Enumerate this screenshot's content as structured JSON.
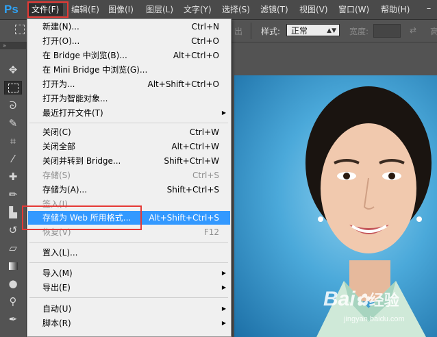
{
  "app": {
    "logo": "Ps"
  },
  "menubar": {
    "items": [
      {
        "label": "文件(F)",
        "active": true
      },
      {
        "label": "编辑(E)"
      },
      {
        "label": "图像(I)"
      },
      {
        "label": "图层(L)"
      },
      {
        "label": "文字(Y)"
      },
      {
        "label": "选择(S)"
      },
      {
        "label": "滤镜(T)"
      },
      {
        "label": "视图(V)"
      },
      {
        "label": "窗口(W)"
      },
      {
        "label": "帮助(H)"
      }
    ]
  },
  "options_bar": {
    "dimmed_label": "出",
    "style_label": "样式:",
    "style_value": "正常",
    "width_label": "宽度:",
    "height_label": "高"
  },
  "file_menu": {
    "items": [
      {
        "label": "新建(N)...",
        "shortcut": "Ctrl+N"
      },
      {
        "label": "打开(O)...",
        "shortcut": "Ctrl+O"
      },
      {
        "label": "在 Bridge 中浏览(B)...",
        "shortcut": "Alt+Ctrl+O"
      },
      {
        "label": "在 Mini Bridge 中浏览(G)...",
        "shortcut": ""
      },
      {
        "label": "打开为...",
        "shortcut": "Alt+Shift+Ctrl+O"
      },
      {
        "label": "打开为智能对象...",
        "shortcut": ""
      },
      {
        "label": "最近打开文件(T)",
        "shortcut": "",
        "submenu": true
      },
      {
        "label": "关闭(C)",
        "shortcut": "Ctrl+W"
      },
      {
        "label": "关闭全部",
        "shortcut": "Alt+Ctrl+W"
      },
      {
        "label": "关闭并转到 Bridge...",
        "shortcut": "Shift+Ctrl+W"
      },
      {
        "label": "存储(S)",
        "shortcut": "Ctrl+S",
        "disabled": true
      },
      {
        "label": "存储为(A)...",
        "shortcut": "Shift+Ctrl+S"
      },
      {
        "label": "签入(I)...",
        "shortcut": "",
        "disabled": true
      },
      {
        "label": "存储为 Web 所用格式...",
        "shortcut": "Alt+Shift+Ctrl+S",
        "highlighted": true
      },
      {
        "label": "恢复(V)",
        "shortcut": "F12",
        "disabled": true
      },
      {
        "label": "置入(L)...",
        "shortcut": ""
      },
      {
        "label": "导入(M)",
        "shortcut": "",
        "submenu": true
      },
      {
        "label": "导出(E)",
        "shortcut": "",
        "submenu": true
      },
      {
        "label": "自动(U)",
        "shortcut": "",
        "submenu": true
      },
      {
        "label": "脚本(R)",
        "shortcut": "",
        "submenu": true
      }
    ]
  },
  "tools": [
    "move-tool-icon",
    "marquee-tool-icon",
    "lasso-tool-icon",
    "quick-select-tool-icon",
    "crop-tool-icon",
    "eyedropper-tool-icon",
    "healing-brush-tool-icon",
    "brush-tool-icon",
    "clone-stamp-tool-icon",
    "history-brush-tool-icon",
    "eraser-tool-icon",
    "gradient-tool-icon",
    "blur-tool-icon",
    "dodge-tool-icon",
    "pen-tool-icon"
  ],
  "watermark": {
    "text": "Bai",
    "suffix": "经验",
    "url": "jingyan.baidu.com"
  }
}
